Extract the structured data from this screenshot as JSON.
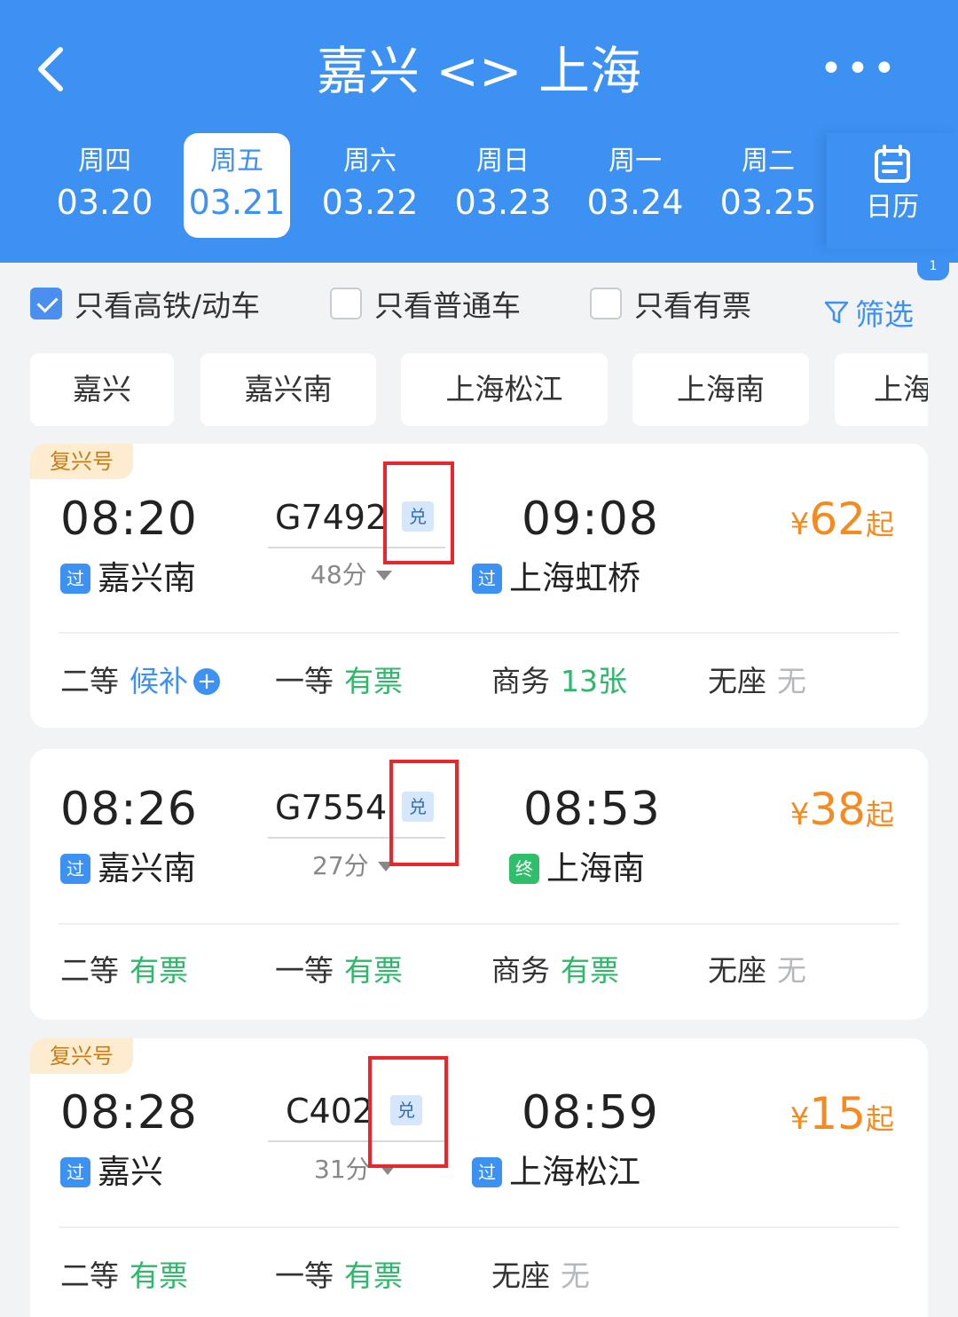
{
  "header": {
    "title": "嘉兴 <> 上海",
    "more_label": "•••",
    "calendar_label": "日历",
    "calendar_badge": "1"
  },
  "dates": [
    {
      "weekday": "周四",
      "date": "03.20"
    },
    {
      "weekday": "周五",
      "date": "03.21",
      "active": true
    },
    {
      "weekday": "周六",
      "date": "03.22"
    },
    {
      "weekday": "周日",
      "date": "03.23"
    },
    {
      "weekday": "周一",
      "date": "03.24"
    },
    {
      "weekday": "周二",
      "date": "03.25"
    }
  ],
  "filters": {
    "high_speed": "只看高铁/动车",
    "normal": "只看普通车",
    "available": "只看有票",
    "filter_btn": "筛选"
  },
  "stations": [
    "嘉兴",
    "嘉兴南",
    "上海松江",
    "上海南",
    "上海"
  ],
  "trains": [
    {
      "tag": "复兴号",
      "depart_time": "08:20",
      "depart_badge": "过",
      "depart_station": "嘉兴南",
      "train_no": "G7492",
      "exchange": "兑",
      "duration": "48分",
      "arrive_time": "09:08",
      "arrive_badge": "过",
      "arrive_station": "上海虹桥",
      "price_currency": "¥",
      "price": "62",
      "price_suffix": "起",
      "seats": [
        {
          "name": "二等",
          "status": "候补"
        },
        {
          "name": "一等",
          "status": "有票"
        },
        {
          "name": "商务",
          "status": "13张"
        },
        {
          "name": "无座",
          "status": "无"
        }
      ]
    },
    {
      "tag": "",
      "depart_time": "08:26",
      "depart_badge": "过",
      "depart_station": "嘉兴南",
      "train_no": "G7554",
      "exchange": "兑",
      "duration": "27分",
      "arrive_time": "08:53",
      "arrive_badge": "终",
      "arrive_station": "上海南",
      "price_currency": "¥",
      "price": "38",
      "price_suffix": "起",
      "seats": [
        {
          "name": "二等",
          "status": "有票"
        },
        {
          "name": "一等",
          "status": "有票"
        },
        {
          "name": "商务",
          "status": "有票"
        },
        {
          "name": "无座",
          "status": "无"
        }
      ]
    },
    {
      "tag": "复兴号",
      "depart_time": "08:28",
      "depart_badge": "过",
      "depart_station": "嘉兴",
      "train_no": "C402",
      "exchange": "兑",
      "duration": "31分",
      "arrive_time": "08:59",
      "arrive_badge": "过",
      "arrive_station": "上海松江",
      "price_currency": "¥",
      "price": "15",
      "price_suffix": "起",
      "seats": [
        {
          "name": "二等",
          "status": "有票"
        },
        {
          "name": "一等",
          "status": "有票"
        },
        {
          "name": "无座",
          "status": "无"
        }
      ]
    }
  ],
  "colors": {
    "header_bg": "#3d91f3",
    "price": "#f58a1f",
    "available": "#2db86a",
    "waitlist": "#3d91f3",
    "none": "#b5b8bc",
    "highlight_box": "#e8262b"
  }
}
